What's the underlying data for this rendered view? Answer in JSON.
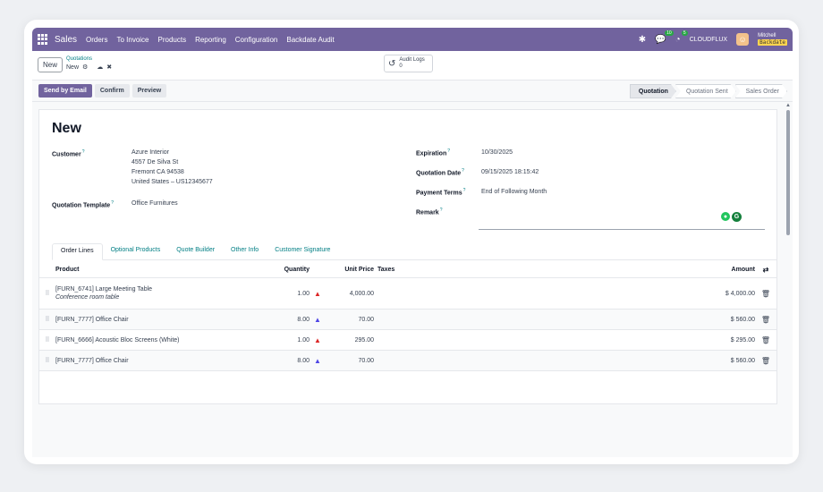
{
  "navbar": {
    "app_name": "Sales",
    "menu": [
      "Orders",
      "To Invoice",
      "Products",
      "Reporting",
      "Configuration",
      "Backdate Audit"
    ],
    "chat_badge": "10",
    "activity_badge": "5",
    "company": "CLOUDFLUX",
    "user_name": "Mitchell",
    "backdate_label": "Backdate"
  },
  "control_panel": {
    "new_label": "New",
    "breadcrumb_parent": "Quotations",
    "breadcrumb_current": "New",
    "audit_label": "Audit Logs",
    "audit_count": "0"
  },
  "actions": {
    "send_email": "Send by Email",
    "confirm": "Confirm",
    "preview": "Preview"
  },
  "status_steps": [
    "Quotation",
    "Quotation Sent",
    "Sales Order"
  ],
  "form": {
    "title": "New",
    "customer_label": "Customer",
    "customer_name": "Azure Interior",
    "address1": "4557 De Silva St",
    "address2": "Fremont CA 94538",
    "address3": "United States – US12345677",
    "template_label": "Quotation Template",
    "template_value": "Office Furnitures",
    "expiration_label": "Expiration",
    "expiration_value": "10/30/2025",
    "quote_date_label": "Quotation Date",
    "quote_date_value": "09/15/2025 18:15:42",
    "payment_terms_label": "Payment Terms",
    "payment_terms_value": "End of Following Month",
    "remark_label": "Remark",
    "help_mark": "?"
  },
  "tabs": [
    "Order Lines",
    "Optional Products",
    "Quote Builder",
    "Other Info",
    "Customer Signature"
  ],
  "table": {
    "headers": {
      "product": "Product",
      "quantity": "Quantity",
      "unit_price": "Unit Price",
      "taxes": "Taxes",
      "amount": "Amount"
    },
    "rows": [
      {
        "product": "[FURN_6741] Large Meeting Table",
        "description": "Conference room table",
        "quantity": "1.00",
        "unit_price": "4,000.00",
        "amount": "$ 4,000.00",
        "forecast_color": "#dc2626"
      },
      {
        "product": "[FURN_7777] Office Chair",
        "description": "",
        "quantity": "8.00",
        "unit_price": "70.00",
        "amount": "$ 560.00",
        "forecast_color": "#4f46e5"
      },
      {
        "product": "[FURN_6666] Acoustic Bloc Screens (White)",
        "description": "",
        "quantity": "1.00",
        "unit_price": "295.00",
        "amount": "$ 295.00",
        "forecast_color": "#dc2626"
      },
      {
        "product": "[FURN_7777] Office Chair",
        "description": "",
        "quantity": "8.00",
        "unit_price": "70.00",
        "amount": "$ 560.00",
        "forecast_color": "#4f46e5"
      }
    ]
  },
  "colors": {
    "brand": "#71639e",
    "link": "#017e84"
  }
}
